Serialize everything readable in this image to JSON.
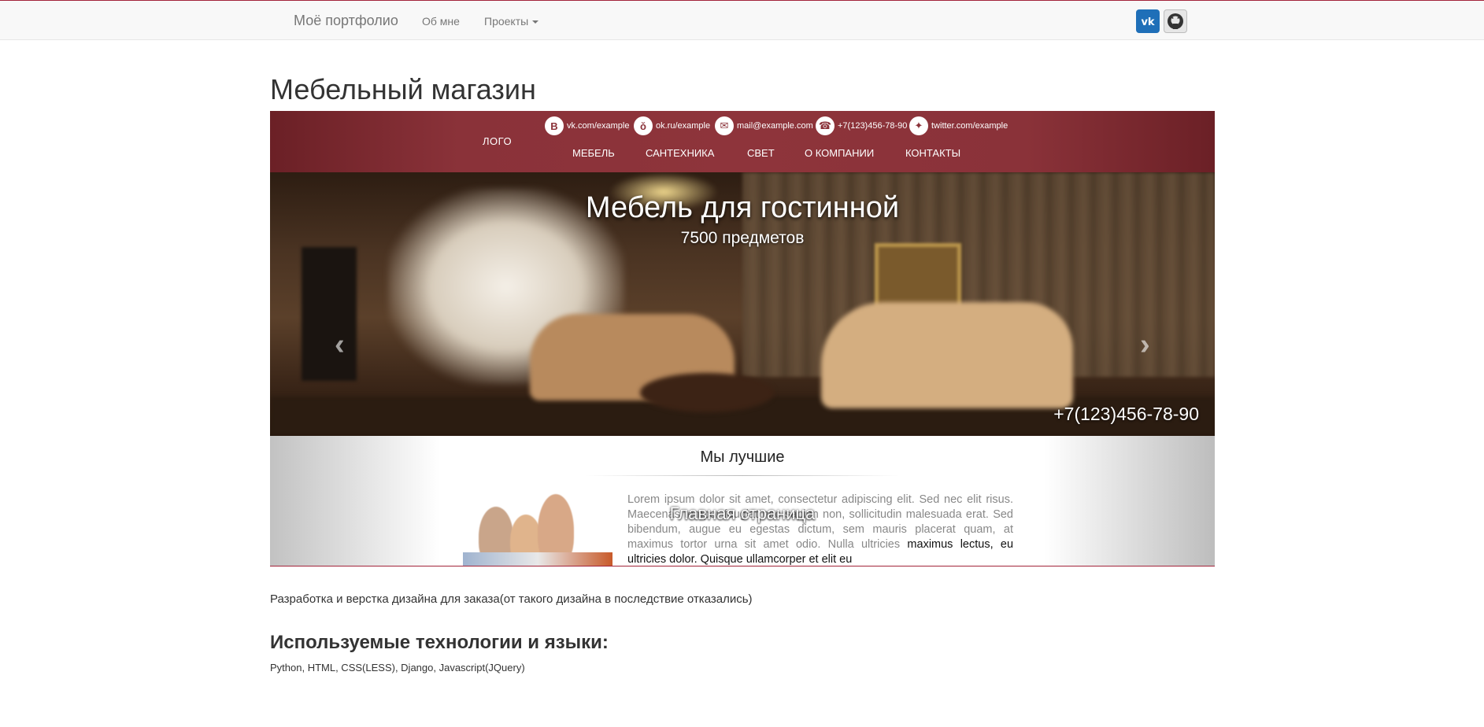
{
  "navbar": {
    "brand": "Моё портфолио",
    "links": [
      {
        "label": "Об мне"
      },
      {
        "label": "Проекты"
      }
    ],
    "social_icons": [
      "vk-icon",
      "github-icon"
    ]
  },
  "page": {
    "title": "Мебельный магазин",
    "description": "Разработка и верстка дизайна для заказа(от такого дизайна в последствие отказались)",
    "tech_heading": "Используемые технологии и языки:",
    "tech_list": "Python, HTML, CSS(LESS), Django, Javascript(JQuery)"
  },
  "showcase": {
    "logo": "ЛОГО",
    "contacts": [
      {
        "icon": "vk-icon",
        "text": "vk.com/example"
      },
      {
        "icon": "odnoklassniki-icon",
        "text": "ok.ru/example"
      },
      {
        "icon": "mail-icon",
        "text": "mail@example.com"
      },
      {
        "icon": "phone-icon",
        "text": "+7(123)456-78-90"
      },
      {
        "icon": "twitter-icon",
        "text": "twitter.com/example"
      }
    ],
    "menu": [
      "МЕБЕЛЬ",
      "САНТЕХНИКА",
      "СВЕТ",
      "О КОМПАНИИ",
      "КОНТАКТЫ"
    ],
    "hero": {
      "title": "Мебель для гостинной",
      "subtitle": "7500 предметов",
      "phone": "+7(123)456-78-90"
    },
    "about": {
      "title": "Мы лучшие",
      "text_light": "Lorem ipsum dolor sit amet, consectetur adipiscing elit. Sed nec elit risus. Maecenas tempor feugiat nec sapien non, sollicitudin malesuada erat. Sed bibendum, augue eu egestas dictum, sem mauris placerat quam, at maximus tortor urna sit amet odio. Nulla ultricies",
      "text_dark": "maximus lectus, eu ultricies dolor. Quisque ullamcorper et elit eu",
      "overlay": "Главная страница"
    }
  },
  "colors": {
    "accent": "#a3243a",
    "header_bg": "#8a3239",
    "vk": "#1f6fb8"
  }
}
